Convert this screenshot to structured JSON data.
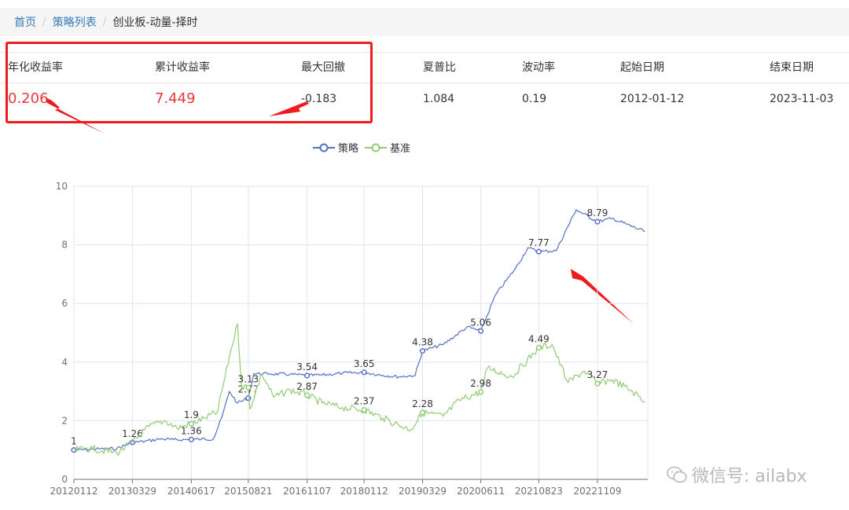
{
  "breadcrumb": {
    "home": "首页",
    "list": "策略列表",
    "current": "创业板-动量-择时"
  },
  "stats": {
    "headers": [
      "年化收益率",
      "累计收益率",
      "最大回撤",
      "夏普比",
      "波动率",
      "起始日期",
      "结束日期"
    ],
    "values": [
      "0.206",
      "7.449",
      "-0.183",
      "1.084",
      "0.19",
      "2012-01-12",
      "2023-11-03"
    ]
  },
  "legend": {
    "strategy": "策略",
    "benchmark": "基准"
  },
  "colors": {
    "strategy": "#5470c6",
    "benchmark": "#91cc75",
    "accent_red": "#e8383d",
    "annotation_red": "#ee1c1c"
  },
  "chart_data": {
    "type": "line",
    "ylim": [
      0,
      10
    ],
    "yticks": [
      "0",
      "2",
      "4",
      "6",
      "8",
      "10"
    ],
    "xticks": [
      "20120112",
      "20130329",
      "20140617",
      "20150821",
      "20161107",
      "20180112",
      "20190329",
      "20200611",
      "20210823",
      "20221109"
    ],
    "series": [
      {
        "name": "策略",
        "points": [
          [
            "20120112",
            1.0
          ],
          [
            "20120401",
            1.02
          ],
          [
            "20120801",
            1.04
          ],
          [
            "20121201",
            1.05
          ],
          [
            "20130329",
            1.26
          ],
          [
            "20130701",
            1.3
          ],
          [
            "20131101",
            1.38
          ],
          [
            "20140201",
            1.35
          ],
          [
            "20140617",
            1.36
          ],
          [
            "20140901",
            1.37
          ],
          [
            "20141201",
            1.38
          ],
          [
            "20150201",
            2.1
          ],
          [
            "20150401",
            3.0
          ],
          [
            "20150601",
            2.6
          ],
          [
            "20150821",
            2.77
          ],
          [
            "20151001",
            3.6
          ],
          [
            "20160201",
            3.6
          ],
          [
            "20160701",
            3.58
          ],
          [
            "20161107",
            3.54
          ],
          [
            "20170301",
            3.56
          ],
          [
            "20170801",
            3.62
          ],
          [
            "20180112",
            3.65
          ],
          [
            "20180601",
            3.55
          ],
          [
            "20181001",
            3.5
          ],
          [
            "20190201",
            3.55
          ],
          [
            "20190329",
            4.38
          ],
          [
            "20190901",
            4.6
          ],
          [
            "20200301",
            5.2
          ],
          [
            "20200611",
            5.06
          ],
          [
            "20201001",
            6.3
          ],
          [
            "20210301",
            7.2
          ],
          [
            "20210601",
            7.9
          ],
          [
            "20210823",
            7.77
          ],
          [
            "20220101",
            7.8
          ],
          [
            "20220601",
            9.2
          ],
          [
            "20221109",
            8.79
          ],
          [
            "20230301",
            8.9
          ],
          [
            "20231103",
            8.45
          ]
        ],
        "labels": [
          [
            "20120112",
            "1"
          ],
          [
            "20130329",
            "1.26"
          ],
          [
            "20140617",
            "1.36"
          ],
          [
            "20150821",
            "2.77"
          ],
          [
            "20161107",
            "3.54"
          ],
          [
            "20180112",
            "3.65"
          ],
          [
            "20190329",
            "4.38"
          ],
          [
            "20200611",
            "5.06"
          ],
          [
            "20210823",
            "7.77"
          ],
          [
            "20221109",
            "8.79"
          ]
        ]
      },
      {
        "name": "基准",
        "points": [
          [
            "20120112",
            1.0
          ],
          [
            "20120601",
            1.05
          ],
          [
            "20121201",
            0.9
          ],
          [
            "20130329",
            1.26
          ],
          [
            "20130801",
            1.8
          ],
          [
            "20131201",
            2.0
          ],
          [
            "20140301",
            1.75
          ],
          [
            "20140617",
            1.9
          ],
          [
            "20141001",
            2.1
          ],
          [
            "20150101",
            2.3
          ],
          [
            "20150401",
            4.2
          ],
          [
            "20150601",
            5.3
          ],
          [
            "20150701",
            3.2
          ],
          [
            "20150821",
            3.13
          ],
          [
            "20150901",
            2.4
          ],
          [
            "20151201",
            3.6
          ],
          [
            "20160301",
            2.8
          ],
          [
            "20160701",
            3.05
          ],
          [
            "20161107",
            2.87
          ],
          [
            "20170301",
            2.6
          ],
          [
            "20170801",
            2.45
          ],
          [
            "20180112",
            2.37
          ],
          [
            "20180601",
            2.1
          ],
          [
            "20181001",
            1.85
          ],
          [
            "20190101",
            1.7
          ],
          [
            "20190329",
            2.28
          ],
          [
            "20190901",
            2.15
          ],
          [
            "20200101",
            2.7
          ],
          [
            "20200611",
            2.98
          ],
          [
            "20200801",
            3.8
          ],
          [
            "20210201",
            3.5
          ],
          [
            "20210823",
            4.49
          ],
          [
            "20211201",
            4.6
          ],
          [
            "20220401",
            3.3
          ],
          [
            "20220801",
            3.7
          ],
          [
            "20221109",
            3.27
          ],
          [
            "20230301",
            3.4
          ],
          [
            "20230801",
            3.0
          ],
          [
            "20231103",
            2.65
          ]
        ],
        "labels": [
          [
            "20140617",
            "1.9"
          ],
          [
            "20150821",
            "3.13"
          ],
          [
            "20161107",
            "2.87"
          ],
          [
            "20180112",
            "2.37"
          ],
          [
            "20190329",
            "2.28"
          ],
          [
            "20200611",
            "2.98"
          ],
          [
            "20210823",
            "4.49"
          ],
          [
            "20221109",
            "3.27"
          ]
        ]
      }
    ]
  },
  "watermark": "微信号: ailabx"
}
